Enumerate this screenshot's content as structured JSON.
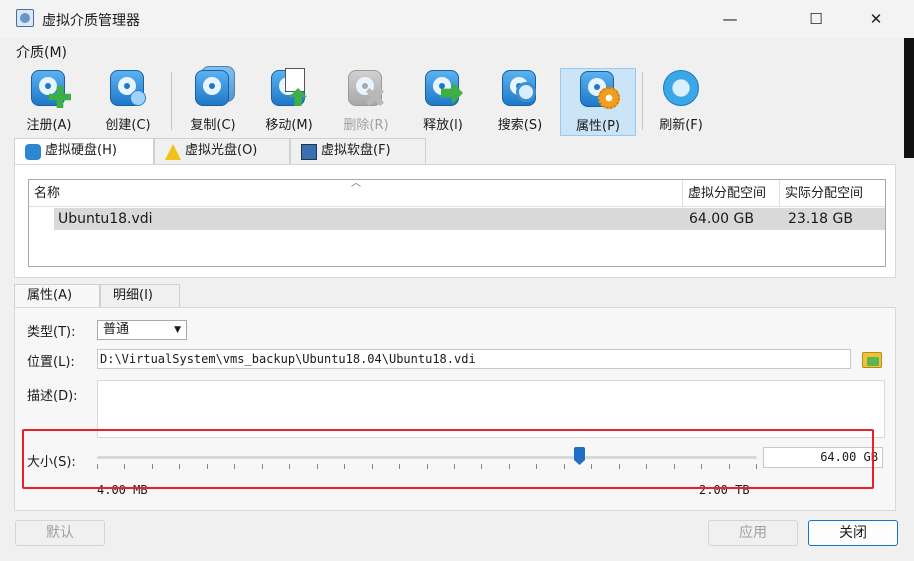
{
  "window": {
    "title": "虚拟介质管理器",
    "minimize": "—",
    "maximize": "☐",
    "close": "✕"
  },
  "menu": {
    "label": "介质(M)"
  },
  "toolbar": [
    {
      "label": "注册(A)",
      "icon": "register-disk-icon",
      "disabled": false,
      "active": false
    },
    {
      "label": "创建(C)",
      "icon": "create-disk-icon",
      "disabled": false,
      "active": false
    },
    {
      "label": "复制(C)",
      "icon": "copy-disk-icon",
      "disabled": false,
      "active": false
    },
    {
      "label": "移动(M)",
      "icon": "move-disk-icon",
      "disabled": false,
      "active": false
    },
    {
      "label": "删除(R)",
      "icon": "delete-disk-icon",
      "disabled": true,
      "active": false
    },
    {
      "label": "释放(l)",
      "icon": "release-disk-icon",
      "disabled": false,
      "active": false
    },
    {
      "label": "搜索(S)",
      "icon": "search-disk-icon",
      "disabled": false,
      "active": false
    },
    {
      "label": "属性(P)",
      "icon": "properties-disk-icon",
      "disabled": false,
      "active": true
    },
    {
      "label": "刷新(F)",
      "icon": "refresh-icon",
      "disabled": false,
      "active": false
    }
  ],
  "media_tabs": [
    {
      "label": "虚拟硬盘(H)",
      "icon": "hard-disk-icon"
    },
    {
      "label": "虚拟光盘(O)",
      "icon": "warning-icon"
    },
    {
      "label": "虚拟软盘(F)",
      "icon": "floppy-disk-icon"
    }
  ],
  "list": {
    "columns": [
      "名称",
      "虚拟分配空间",
      "实际分配空间"
    ],
    "rows": [
      {
        "name": "Ubuntu18.vdi",
        "virtual_size": "64.00 GB",
        "actual_size": "23.18 GB"
      }
    ]
  },
  "detail_tabs": [
    {
      "label": "属性(A)"
    },
    {
      "label": "明细(I)"
    }
  ],
  "properties": {
    "type_label": "类型(T):",
    "type_value": "普通",
    "location_label": "位置(L):",
    "location_value": "D:\\VirtualSystem\\vms_backup\\Ubuntu18.04\\Ubuntu18.vdi",
    "description_label": "描述(D):",
    "size_label": "大小(S):",
    "size_value": "64.00 GB",
    "size_min": "4.00 MB",
    "size_max": "2.00 TB",
    "slider_fraction": 0.73
  },
  "buttons": {
    "reset": "默认",
    "apply": "应用",
    "close": "关闭"
  },
  "colors": {
    "highlight": "#e8202a",
    "accent": "#1a73c7",
    "selected_row": "#d9d9d9"
  }
}
